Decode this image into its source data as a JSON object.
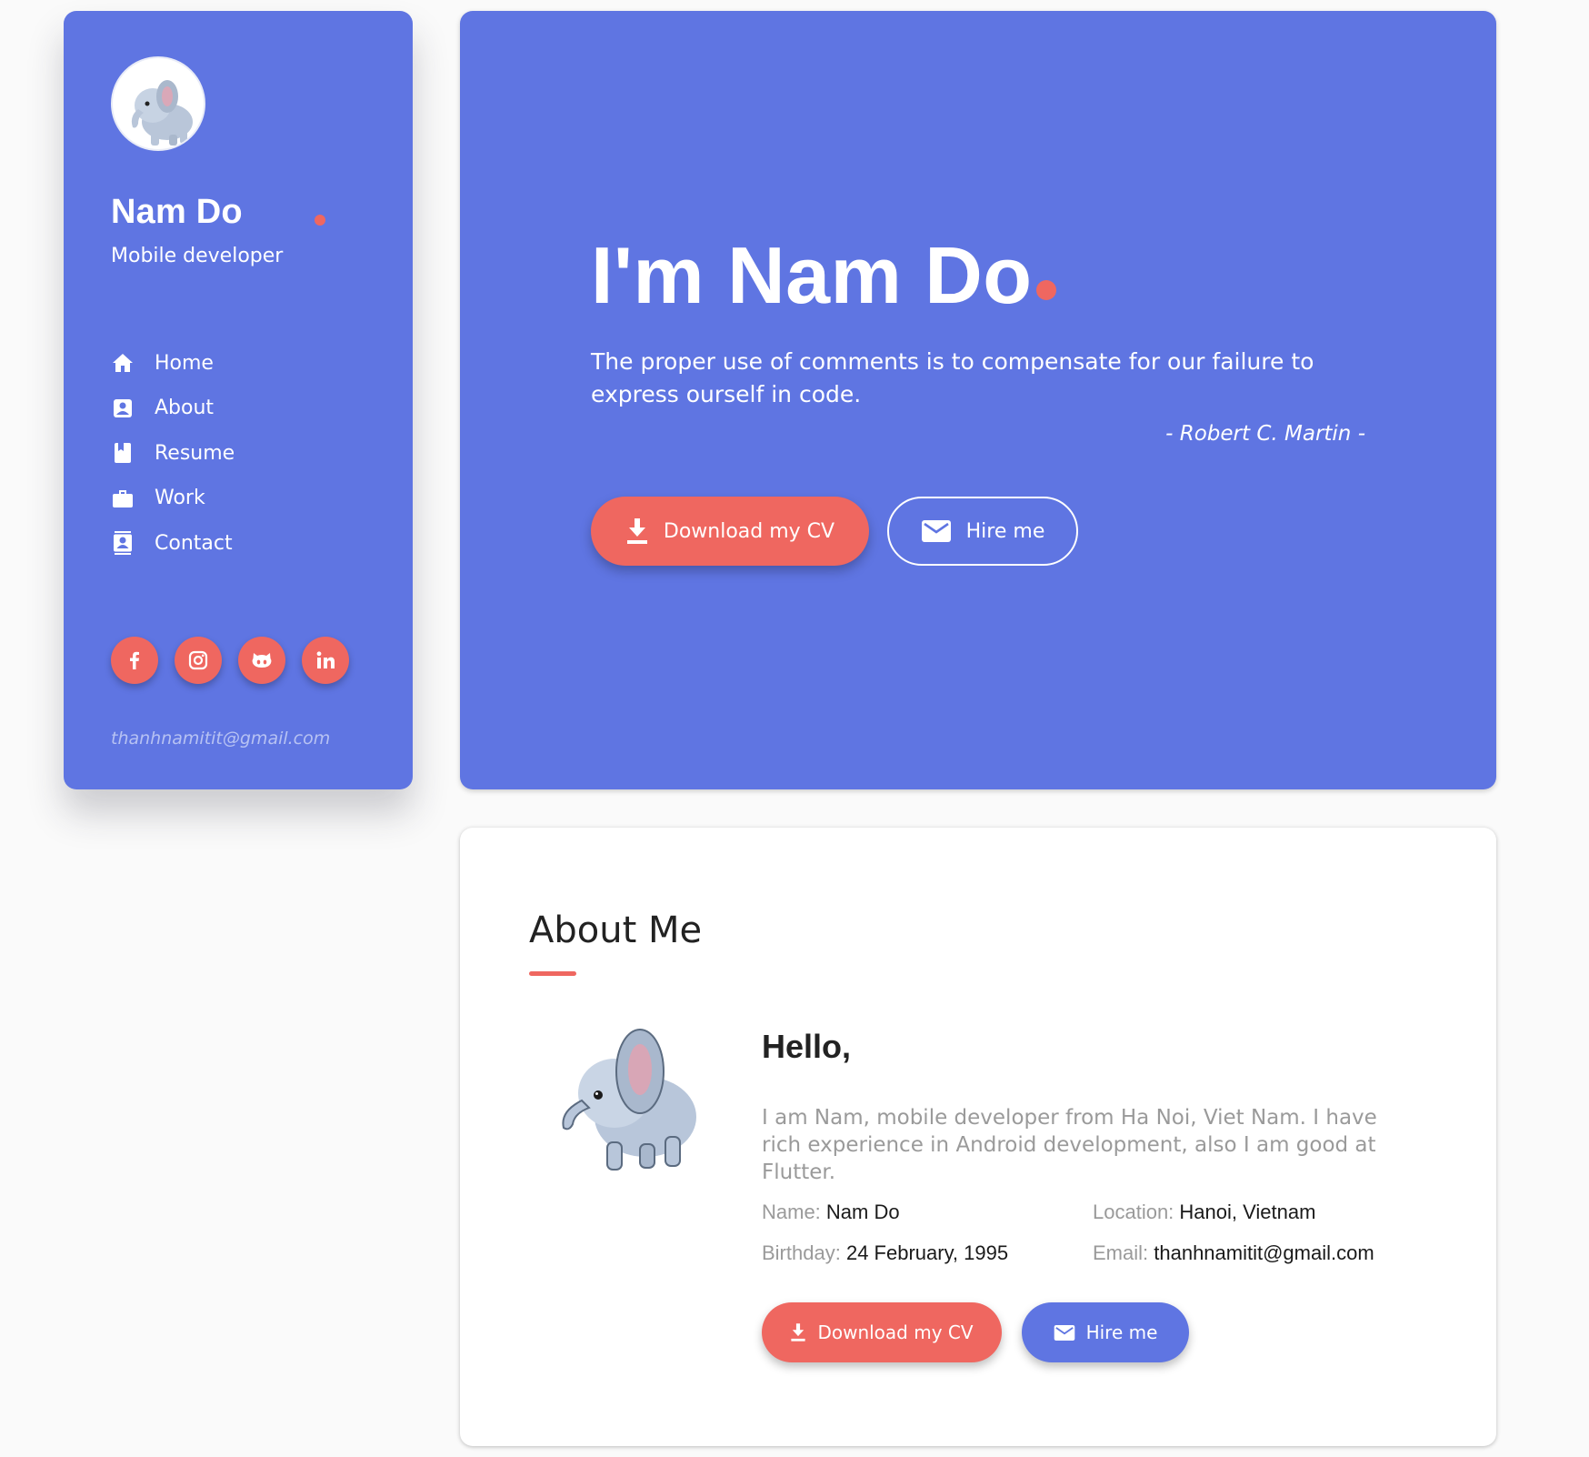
{
  "sidebar": {
    "name": "Nam Do",
    "role": "Mobile developer",
    "nav": [
      {
        "label": "Home",
        "icon": "home-icon"
      },
      {
        "label": "About",
        "icon": "person-box-icon"
      },
      {
        "label": "Resume",
        "icon": "book-icon"
      },
      {
        "label": "Work",
        "icon": "briefcase-icon"
      },
      {
        "label": "Contact",
        "icon": "contact-icon"
      }
    ],
    "socials": [
      "facebook-icon",
      "instagram-icon",
      "github-icon",
      "linkedin-icon"
    ],
    "email": "thanhnamitit@gmail.com"
  },
  "hero": {
    "title": "I'm Nam Do",
    "quote": "The proper use of comments is to compensate for our failure to express ourself in code.",
    "author": "- Robert C. Martin -",
    "download_label": "Download my CV",
    "hire_label": "Hire me"
  },
  "about": {
    "title": "About Me",
    "hello": "Hello,",
    "bio": "I am Nam, mobile developer from Ha Noi, Viet Nam. I have rich experience in Android development, also I am good at Flutter.",
    "info": {
      "name_key": "Name:",
      "name_val": "Nam Do",
      "location_key": "Location:",
      "location_val": "Hanoi, Vietnam",
      "birthday_key": "Birthday:",
      "birthday_val": "24 February, 1995",
      "email_key": "Email:",
      "email_val": "thanhnamitit@gmail.com"
    },
    "download_label": "Download my CV",
    "hire_label": "Hire me"
  },
  "colors": {
    "primary": "#5f75e2",
    "accent": "#ef6760",
    "background": "#fafafa"
  }
}
